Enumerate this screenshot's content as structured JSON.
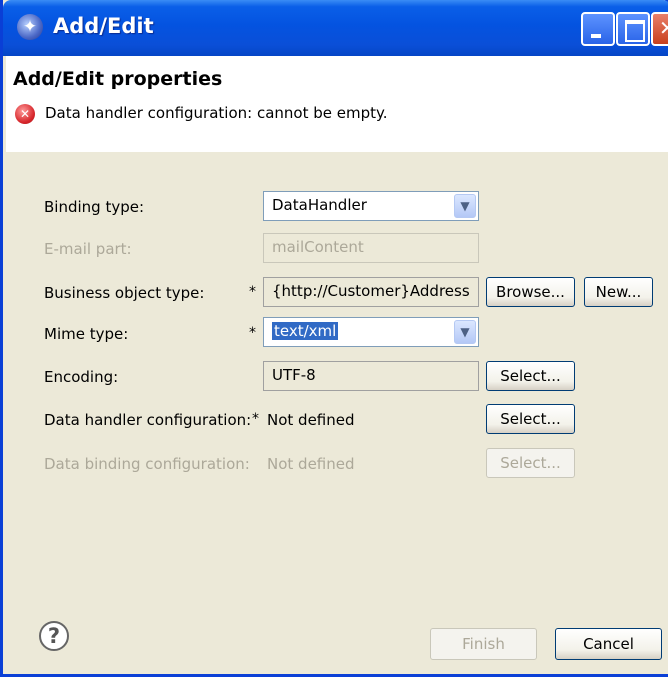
{
  "window": {
    "title": "Add/Edit"
  },
  "header": {
    "title": "Add/Edit properties",
    "error_message": "Data handler configuration: cannot be empty."
  },
  "form": {
    "binding_type": {
      "label": "Binding type:",
      "value": "DataHandler"
    },
    "email_part": {
      "label": "E-mail part:",
      "value": "mailContent"
    },
    "business_object_type": {
      "label": "Business object type:",
      "required_marker": "*",
      "value": "{http://Customer}Address",
      "browse_label": "Browse...",
      "new_label": "New..."
    },
    "mime_type": {
      "label": "Mime type:",
      "required_marker": "*",
      "value": "text/xml"
    },
    "encoding": {
      "label": "Encoding:",
      "value": "UTF-8",
      "select_label": "Select..."
    },
    "data_handler_configuration": {
      "label": "Data handler configuration:",
      "required_marker": "*",
      "value": "Not defined",
      "select_label": "Select..."
    },
    "data_binding_configuration": {
      "label": "Data binding configuration:",
      "value": "Not defined",
      "select_label": "Select..."
    }
  },
  "footer": {
    "finish_label": "Finish",
    "cancel_label": "Cancel"
  }
}
